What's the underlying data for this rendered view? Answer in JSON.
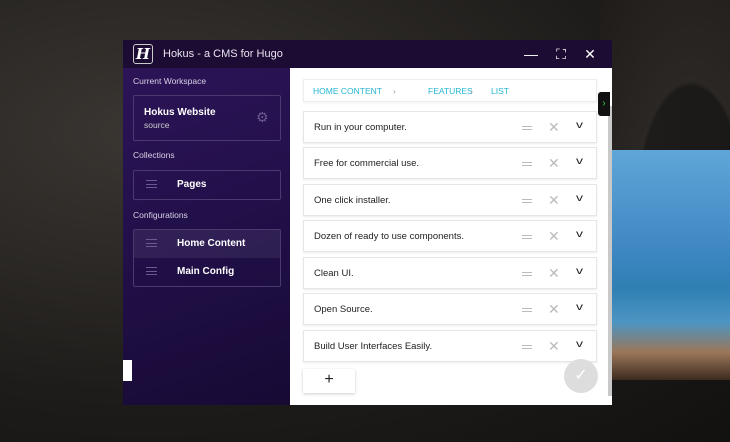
{
  "window": {
    "title": "Hokus - a CMS for Hugo",
    "logo": "H"
  },
  "sidebar": {
    "workspace_label": "Current Workspace",
    "workspace": {
      "name": "Hokus Website",
      "sub": "source"
    },
    "collections_label": "Collections",
    "collections": [
      {
        "label": "Pages"
      }
    ],
    "configurations_label": "Configurations",
    "configurations": [
      {
        "label": "Home Content"
      },
      {
        "label": "Main Config"
      }
    ]
  },
  "breadcrumb": [
    "HOME CONTENT",
    "FEATURES",
    "LIST"
  ],
  "items": [
    {
      "label": "Run in your computer."
    },
    {
      "label": "Free for commercial use."
    },
    {
      "label": "One click installer."
    },
    {
      "label": "Dozen of ready to use components."
    },
    {
      "label": "Clean UI."
    },
    {
      "label": "Open Source."
    },
    {
      "label": "Build User Interfaces Easily."
    }
  ],
  "colors": {
    "accent": "#25b5d4",
    "titlebar": "#1c0b33",
    "sidebar": "#22104a"
  }
}
